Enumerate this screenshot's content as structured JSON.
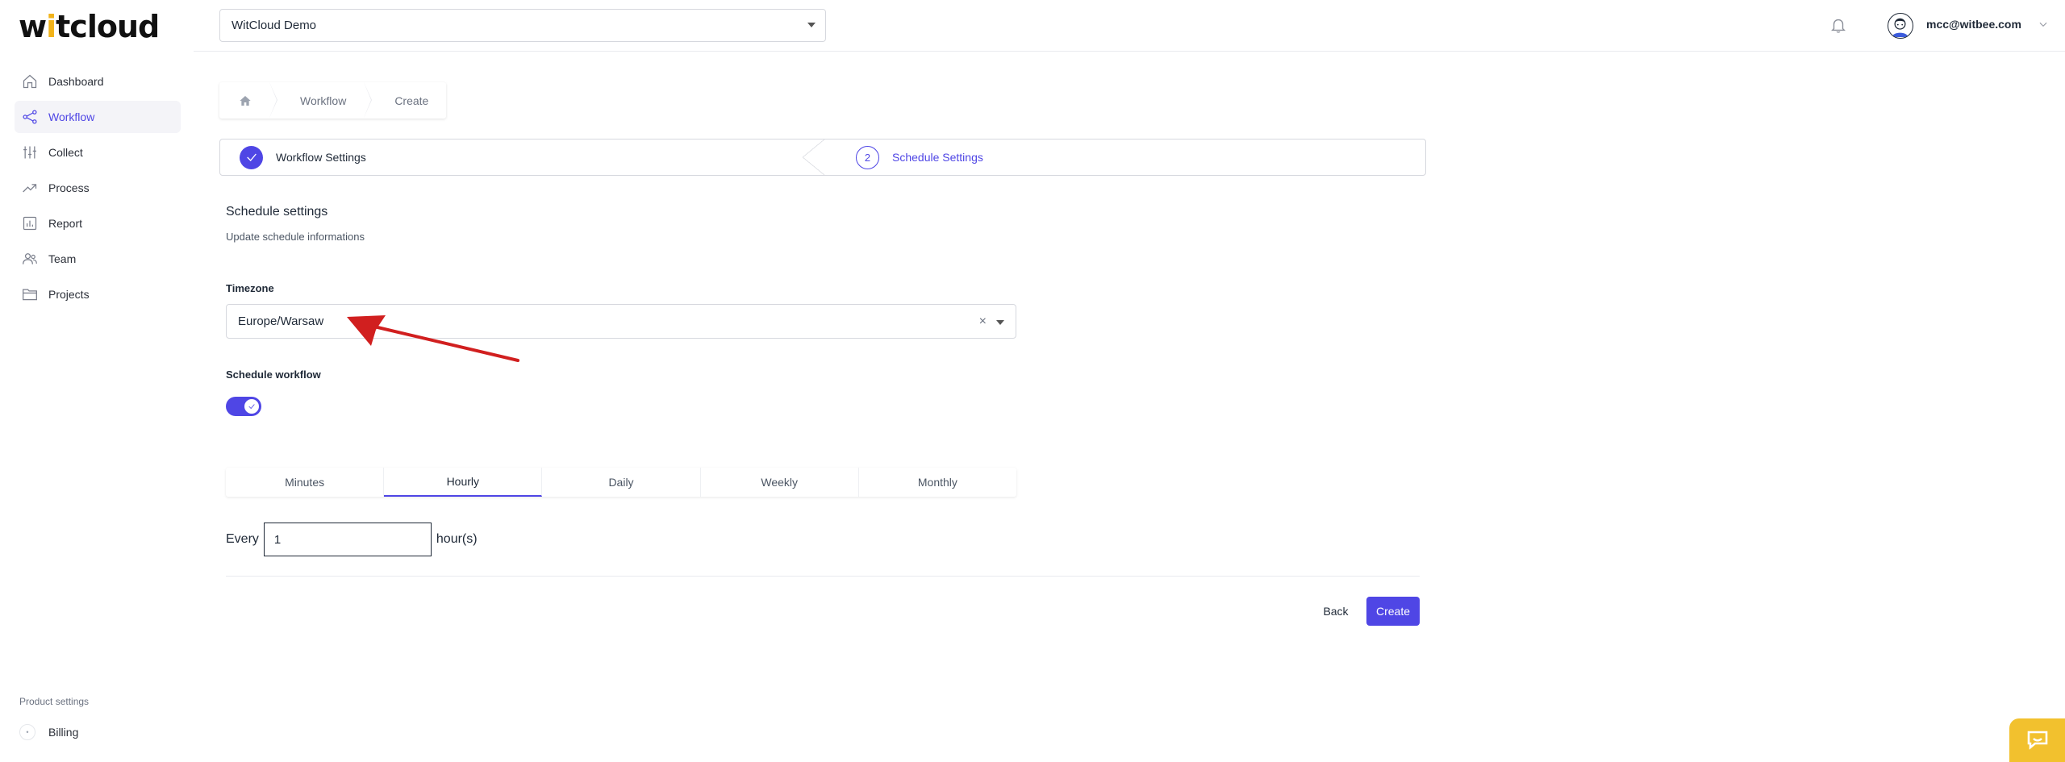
{
  "app": {
    "logo_part1": "w",
    "logo_accent": "i",
    "logo_part2": "tcloud"
  },
  "sidebar": {
    "items": [
      {
        "label": "Dashboard",
        "icon": "home-icon",
        "active": false
      },
      {
        "label": "Workflow",
        "icon": "share-icon",
        "active": true
      },
      {
        "label": "Collect",
        "icon": "sliders-icon",
        "active": false
      },
      {
        "label": "Process",
        "icon": "trend-icon",
        "active": false
      },
      {
        "label": "Report",
        "icon": "report-icon",
        "active": false
      },
      {
        "label": "Team",
        "icon": "users-icon",
        "active": false
      },
      {
        "label": "Projects",
        "icon": "folder-icon",
        "active": false
      }
    ],
    "footer_label": "Product settings",
    "billing_label": "Billing",
    "billing_icon_char": "•"
  },
  "topbar": {
    "org_select_value": "WitCloud Demo",
    "user_email": "mcc@witbee.com"
  },
  "breadcrumb": {
    "items": [
      "Workflow",
      "Create"
    ]
  },
  "stepper": {
    "step1_label": "Workflow Settings",
    "step2_number": "2",
    "step2_label": "Schedule Settings"
  },
  "form": {
    "title": "Schedule settings",
    "subtitle": "Update schedule informations",
    "timezone_label": "Timezone",
    "timezone_value": "Europe/Warsaw",
    "clear_char": "×",
    "schedule_label": "Schedule workflow",
    "schedule_enabled": true,
    "tabs": [
      "Minutes",
      "Hourly",
      "Daily",
      "Weekly",
      "Monthly"
    ],
    "active_tab": "Hourly",
    "every_prefix": "Every",
    "every_value": "1",
    "every_suffix": "hour(s)"
  },
  "actions": {
    "back_label": "Back",
    "create_label": "Create"
  },
  "colors": {
    "accent": "#4f46e5",
    "logo_accent": "#f2b319",
    "chat_widget": "#f2c12e",
    "annotation_arrow": "#d11f1f"
  }
}
